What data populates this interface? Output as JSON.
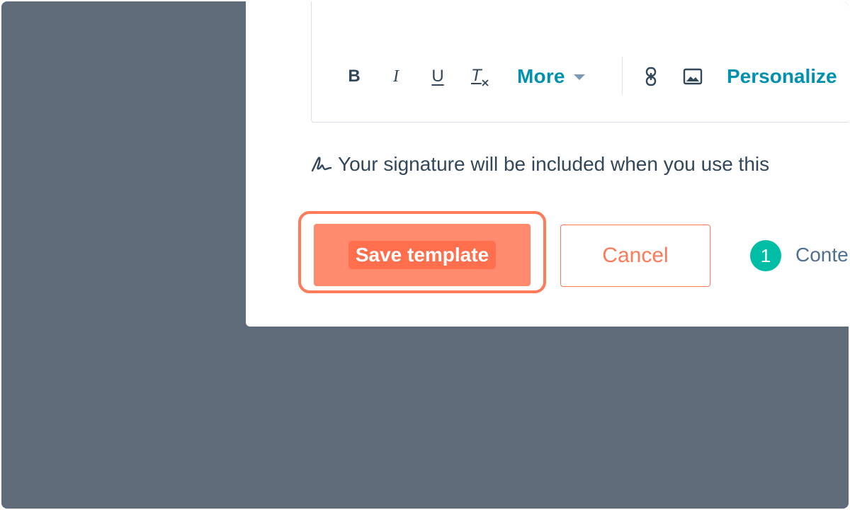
{
  "toolbar": {
    "bold_label": "B",
    "italic_label": "I",
    "underline_label": "U",
    "clear_format_label": "T",
    "more_label": "More",
    "personalize_label": "Personalize",
    "icons": {
      "clear_format": "clear-formatting-icon",
      "more_caret": "caret-down-icon",
      "link": "link-icon",
      "image": "image-icon"
    }
  },
  "signature_notice": {
    "icon": "signature-icon",
    "text": "Your signature will be included when you use this"
  },
  "actions": {
    "save_label": "Save template",
    "cancel_label": "Cancel"
  },
  "step": {
    "number": "1",
    "label": "Conte"
  },
  "colors": {
    "backdrop": "#5f6b79",
    "accent_orange": "#ff7a59",
    "link_teal": "#0091ae",
    "text_dark": "#33475b",
    "step_green": "#00bda5"
  }
}
